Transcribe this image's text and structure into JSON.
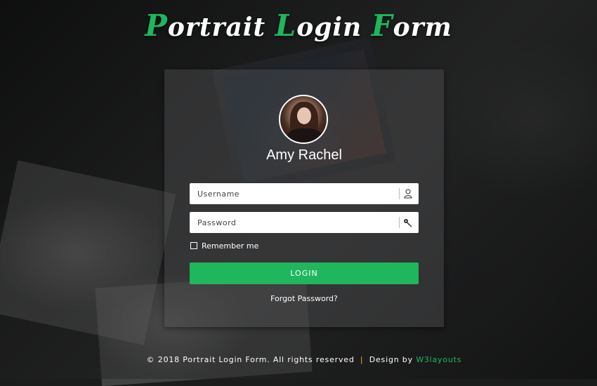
{
  "header": {
    "title_words": [
      {
        "initial": "P",
        "rest": "ortrait"
      },
      {
        "initial": "L",
        "rest": "ogin"
      },
      {
        "initial": "F",
        "rest": "orm"
      }
    ]
  },
  "profile": {
    "name": "Amy Rachel"
  },
  "form": {
    "username_placeholder": "Username",
    "password_placeholder": "Password",
    "remember_label": "Remember me",
    "remember_checked": false,
    "login_label": "LOGIN",
    "forgot_label": "Forgot Password?"
  },
  "footer": {
    "copyright": "© 2018 Portrait Login Form. All rights reserved",
    "separator": "|",
    "design_prefix": "Design by",
    "design_link": "W3layouts"
  },
  "colors": {
    "accent": "#1fb65e",
    "separator": "#e3b020",
    "text": "#ffffff"
  },
  "icons": {
    "username": "user-icon",
    "password": "key-icon"
  }
}
